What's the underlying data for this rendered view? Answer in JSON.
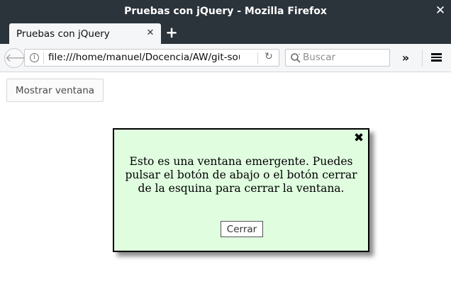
{
  "window": {
    "title": "Pruebas con jQuery - Mozilla Firefox",
    "close_glyph": "✕"
  },
  "tabs": [
    {
      "label": "Pruebas con jQuery",
      "close_glyph": "✕",
      "active": true
    }
  ],
  "tabbar": {
    "new_tab_glyph": "+"
  },
  "navbar": {
    "back_glyph": "🡐",
    "url": "file:///home/manuel/Docencia/AW/git-sou",
    "info_glyph": "i",
    "reload_glyph": "↻",
    "search_placeholder": "Buscar",
    "overflow_glyph": "»",
    "icons": [
      "back-icon",
      "info-icon",
      "reload-icon",
      "search-icon",
      "overflow-icon",
      "hamburger-menu-icon"
    ]
  },
  "page": {
    "show_button_label": "Mostrar ventana",
    "popup": {
      "close_glyph": "✖",
      "message": "Esto es una ventana emergente. Puedes pulsar el botón de abajo o el botón cerrar de la esquina para cerrar la ventana.",
      "button_label": "Cerrar",
      "background_color": "#e0fde0"
    }
  },
  "colors": {
    "chrome_dark": "#2b333b",
    "toolbar": "#f5f6f7"
  }
}
